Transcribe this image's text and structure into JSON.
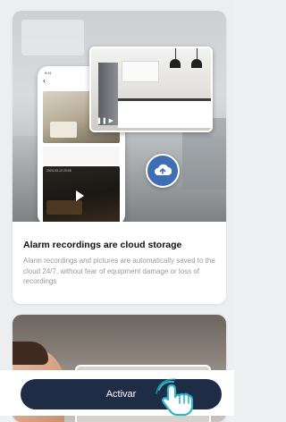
{
  "feature_card": {
    "title": "Alarm recordings are cloud storage",
    "description": "Alarm recordings and pictures are automatically saved to the cloud 24/7, without fear of equipment damage or loss of recordings",
    "phone_time": "9:41",
    "video_timestamp": "2023-03-12 20:05"
  },
  "actions": {
    "activate_label": "Activar"
  },
  "colors": {
    "accent": "#3f6fb2",
    "button_bg": "#1e2d45",
    "hand_icon": "#2fb5c9"
  }
}
